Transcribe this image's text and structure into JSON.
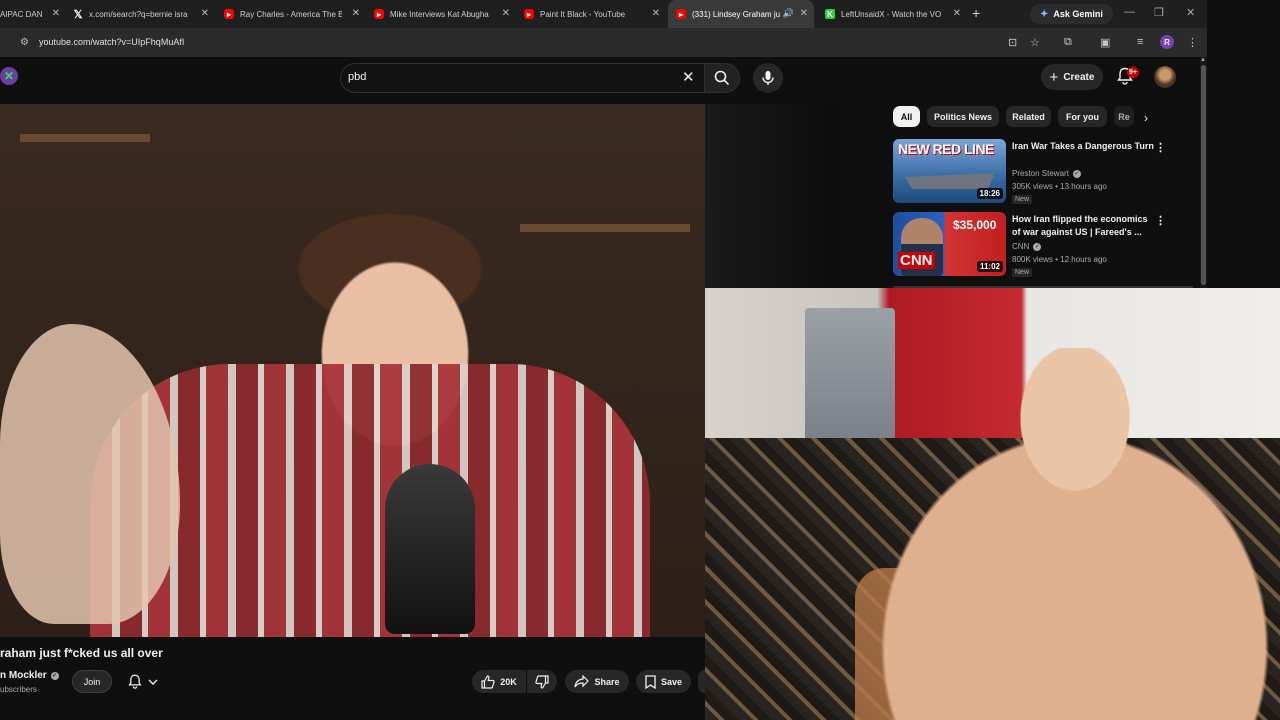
{
  "browser": {
    "tabs": [
      {
        "label": "AIPAC DAN",
        "icon": "tab-favicon",
        "active": false
      },
      {
        "label": "x.com/search?q=bernie isra",
        "icon": "x-logo-icon",
        "active": false
      },
      {
        "label": "Ray Charles - America The B",
        "icon": "youtube-icon",
        "active": false
      },
      {
        "label": "Mike Interviews Kat Abugha",
        "icon": "youtube-icon",
        "active": false
      },
      {
        "label": "Paint It Black - YouTube",
        "icon": "youtube-icon",
        "active": false
      },
      {
        "label": "(331) Lindsey Graham ju",
        "icon": "youtube-icon",
        "active": true
      },
      {
        "label": "LeftUnsaidX - Watch the VO",
        "icon": "green-favicon",
        "active": false
      }
    ],
    "ask_gemini_label": "Ask Gemini",
    "url": "youtube.com/watch?v=UIpFhqMuAfI",
    "profile_initial": "R"
  },
  "youtube": {
    "search": {
      "query": "pbd"
    },
    "create_label": "Create",
    "notifications_badge": "9+",
    "chips": [
      "All",
      "Politics News",
      "Related",
      "For you",
      "Re"
    ],
    "recommendations": [
      {
        "thumb_text": "NEW RED LINE",
        "duration": "18:26",
        "title": "Iran War Takes a Dangerous Turn",
        "channel": "Preston Stewart",
        "meta": "305K views • 13 hours ago",
        "badge": "New"
      },
      {
        "thumb_text": "$35,000",
        "thumb_logo": "CNN",
        "duration": "11:02",
        "title": "How Iran flipped the economics of war against US | Fareed's ...",
        "channel": "CNN",
        "meta": "800K views • 12 hours ago",
        "badge": "New"
      }
    ],
    "video": {
      "title": "raham just f*cked us all over",
      "channel": "n Mockler",
      "subscribers": "ubscribers",
      "join_label": "Join",
      "likes": "20K",
      "share_label": "Share",
      "save_label": "Save"
    }
  }
}
